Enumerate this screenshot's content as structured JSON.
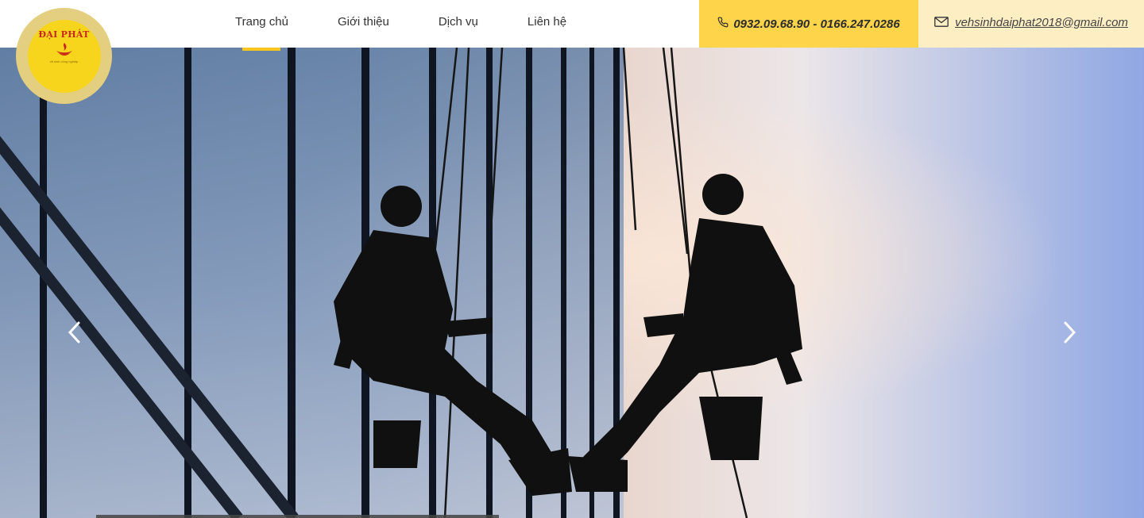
{
  "brand": {
    "name": "ĐẠI PHÁT",
    "tagline": "vệ sinh công nghiệp"
  },
  "nav": {
    "items": [
      {
        "label": "Trang chủ",
        "active": true
      },
      {
        "label": "Giới thiệu",
        "active": false
      },
      {
        "label": "Dịch vụ",
        "active": false
      },
      {
        "label": "Liên hệ",
        "active": false
      }
    ]
  },
  "contact": {
    "phone": "0932.09.68.90 - 0166.247.0286",
    "email": "vehsinhdaiphat2018@gmail.com"
  },
  "icons": {
    "phone": "phone-icon",
    "mail": "mail-icon",
    "prev": "chevron-left-icon",
    "next": "chevron-right-icon"
  },
  "colors": {
    "accent": "#f7c51c",
    "phone_bg": "#fdd44a",
    "mail_bg": "#fdeec4",
    "logo_red": "#c8261c"
  }
}
